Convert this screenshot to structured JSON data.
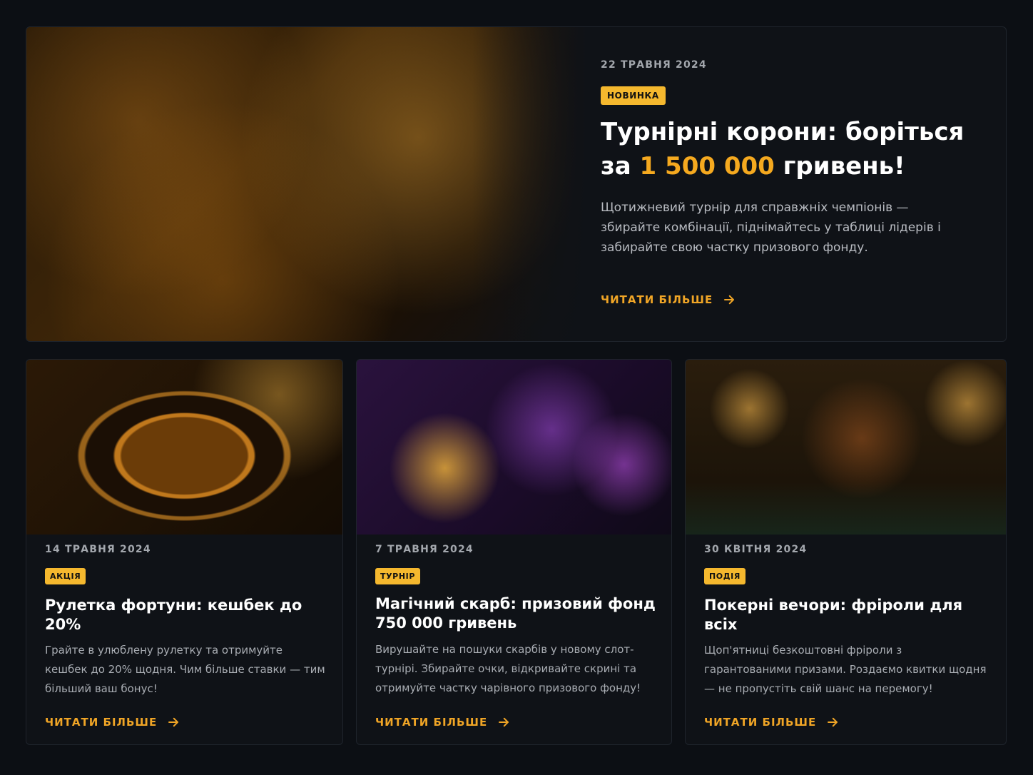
{
  "hero": {
    "date": "22 ТРАВНЯ 2024",
    "badge": "НОВИНКА",
    "title_line1": "Турнірні корони: боріться",
    "title_prefix": "за ",
    "title_highlight": "1 500 000",
    "title_suffix": " гривень!",
    "description": "Щотижневий турнір для справжніх чемпіонів — збирайте комбінації, піднімайтесь у таблиці лідерів і забирайте свою частку призового фонду.",
    "read_more": "ЧИТАТИ БІЛЬШЕ",
    "image_icon": "crowned-king-on-throne-illustration"
  },
  "cards": [
    {
      "date": "14 ТРАВНЯ 2024",
      "badge": "АКЦІЯ",
      "title": "Рулетка фортуни: кешбек до 20%",
      "description": "Грайте в улюблену рулетку та отримуйте кешбек до 20% щодня. Чим більше ставки — тим більший ваш бонус!",
      "read_more": "ЧИТАТИ БІЛЬШЕ",
      "image_icon": "golden-roulette-illustration"
    },
    {
      "date": "7 ТРАВНЯ 2024",
      "badge": "ТУРНІР",
      "title": "Магічний скарб: призовий фонд 750 000 гривень",
      "description": "Вирушайте на пошуки скарбів у новому слот-турнірі. Збирайте очки, відкривайте скрині та отримуйте частку чарівного призового фонду!",
      "read_more": "ЧИТАТИ БІЛЬШЕ",
      "image_icon": "sorceress-treasure-chest-illustration"
    },
    {
      "date": "30 КВІТНЯ 2024",
      "badge": "ПОДІЯ",
      "title": "Покерні вечори: фріроли для всіх",
      "description": "Щоп'ятниці безкоштовні фріроли з гарантованими призами. Роздаємо квитки щодня — не пропустіть свій шанс на перемогу!",
      "read_more": "ЧИТАТИ БІЛЬШЕ",
      "image_icon": "dragon-poker-player-illustration"
    }
  ],
  "colors": {
    "accent": "#f5a91f",
    "badge_bg": "#f5b82e",
    "background": "#0c0f14",
    "card_bg": "#0f1217"
  },
  "icons": {
    "arrow": "arrow-right-icon"
  }
}
